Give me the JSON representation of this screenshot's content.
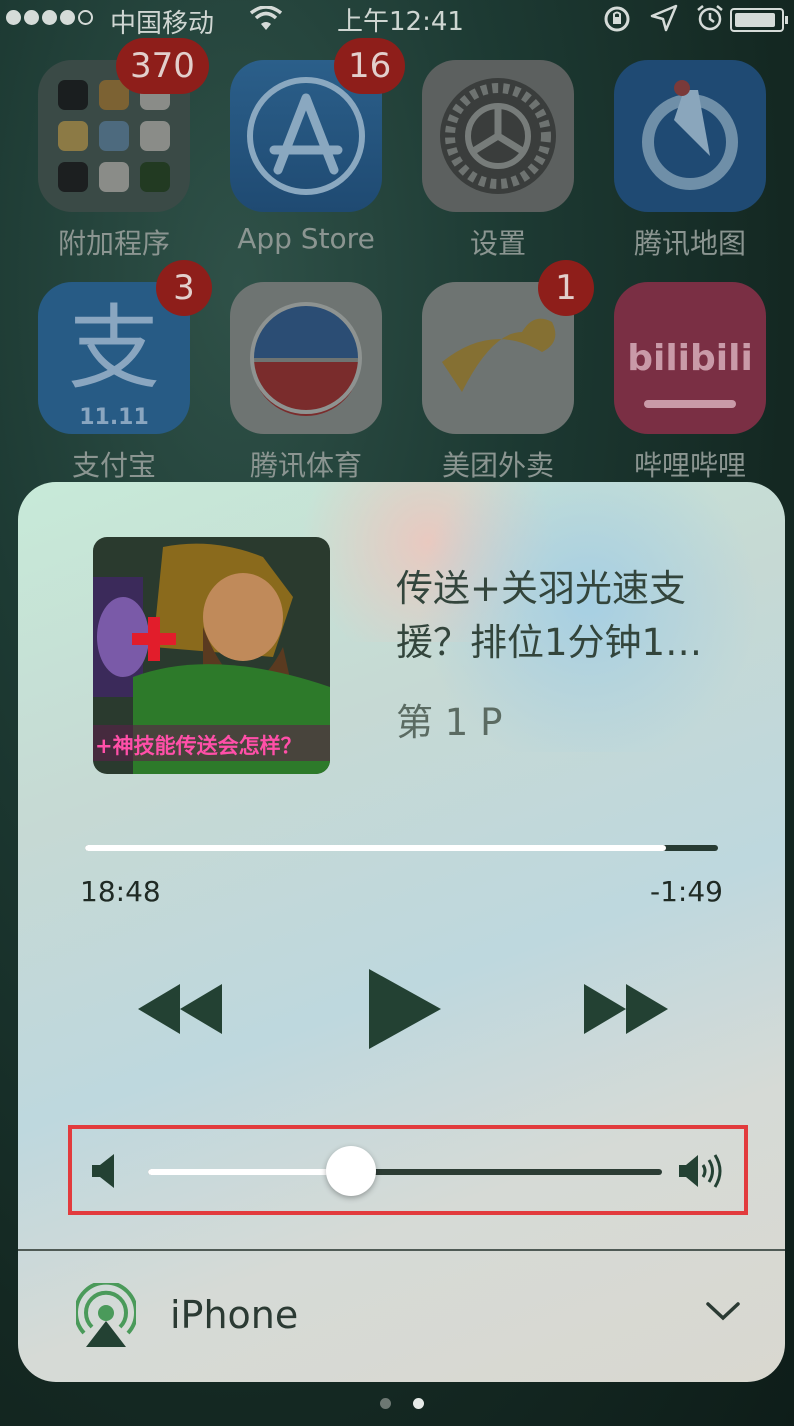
{
  "status_bar": {
    "carrier": "中国移动",
    "time": "上午12:41"
  },
  "home_apps": [
    {
      "label": "附加程序",
      "badge": "370"
    },
    {
      "label": "App Store",
      "badge": "16"
    },
    {
      "label": "设置",
      "badge": ""
    },
    {
      "label": "腾讯地图",
      "badge": ""
    },
    {
      "label": "支付宝",
      "badge": "3"
    },
    {
      "label": "腾讯体育",
      "badge": ""
    },
    {
      "label": "美团外卖",
      "badge": "1"
    },
    {
      "label": "哔哩哔哩",
      "badge": ""
    }
  ],
  "alipay_tile_text": "11.11",
  "bilibili_tile_text": "bilibili",
  "now_playing": {
    "artwork_caption": "+神技能传送会怎样？",
    "title": "传送+关羽光速支援？排位1分钟1…",
    "subtitle": "第 1 P",
    "elapsed": "18:48",
    "remaining": "-1:49",
    "progress_fraction": 0.918,
    "volume_fraction": 0.395
  },
  "output_route": {
    "device_name": "iPhone"
  },
  "page_indicator": {
    "count": 2,
    "active": 2
  },
  "colors": {
    "badge_red": "#8e1e1a",
    "highlight_red": "#e23b3d",
    "control_dark": "#234133"
  }
}
